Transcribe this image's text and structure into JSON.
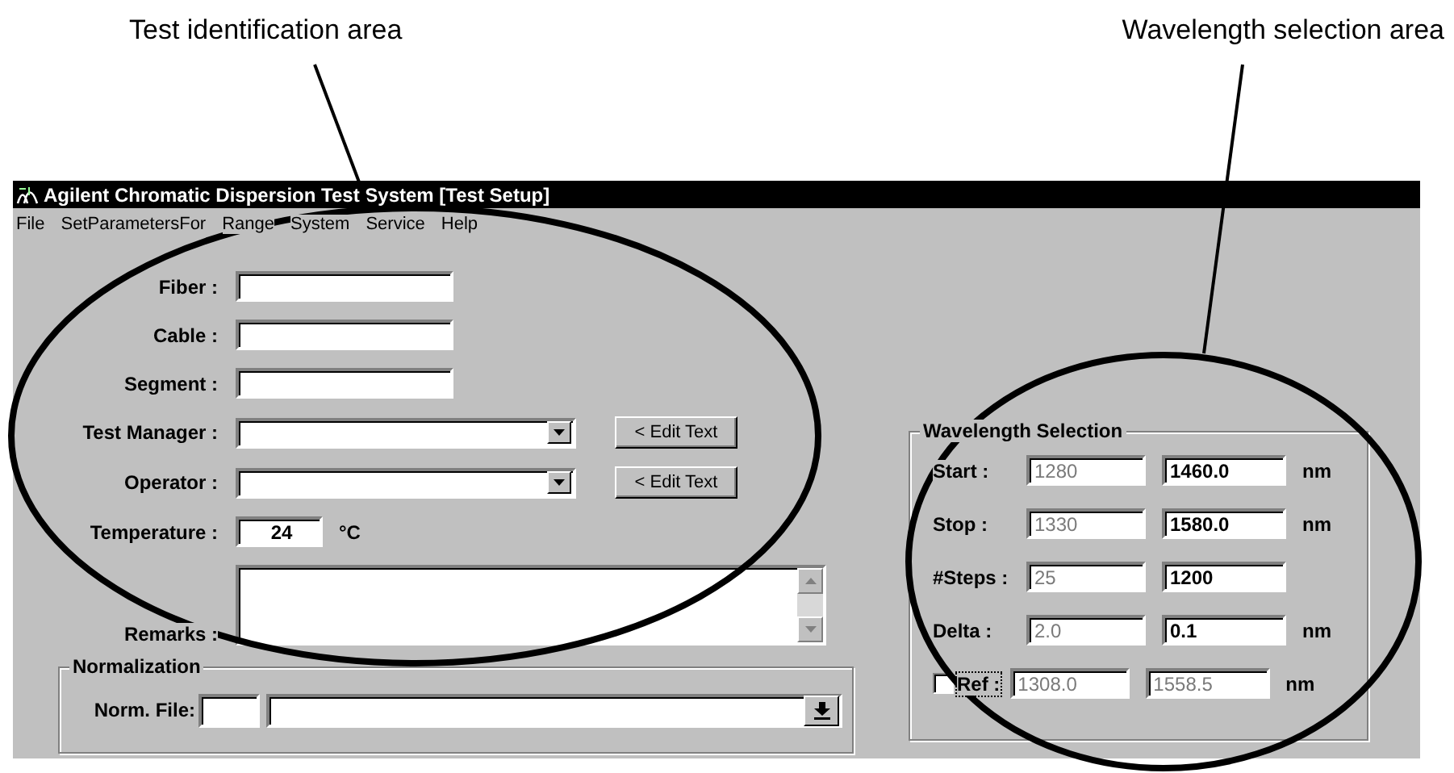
{
  "annotations": [
    {
      "label": "Test identification area"
    },
    {
      "label": "Wavelength selection area"
    }
  ],
  "window": {
    "title": "Agilent Chromatic Dispersion Test System [Test Setup]"
  },
  "menu": [
    "File",
    "SetParametersFor",
    "Range",
    "System",
    "Service",
    "Help"
  ],
  "test_identification": {
    "fields": [
      {
        "kind": "text",
        "label": "Fiber :"
      },
      {
        "kind": "text",
        "label": "Cable :"
      },
      {
        "kind": "text",
        "label": "Segment :"
      },
      {
        "kind": "combo",
        "label": "Test Manager :",
        "button": "< Edit Text"
      },
      {
        "kind": "combo",
        "label": "Operator :",
        "button": "< Edit Text"
      },
      {
        "kind": "number",
        "label": "Temperature :",
        "value": "24",
        "unit": "°C"
      },
      {
        "kind": "memo",
        "label": "Remarks :"
      }
    ]
  },
  "normalization": {
    "title": "Normalization",
    "label": "Norm. File:"
  },
  "wavelength_selection": {
    "title": "Wavelength Selection",
    "rows": [
      {
        "kind": "plain",
        "label": "Start :",
        "default": {
          "value": "1280",
          "disabled": true
        },
        "setting": {
          "value": "1460.0",
          "disabled": false
        },
        "unit": "nm"
      },
      {
        "kind": "plain",
        "label": "Stop :",
        "default": {
          "value": "1330",
          "disabled": true
        },
        "setting": {
          "value": "1580.0",
          "disabled": false
        },
        "unit": "nm"
      },
      {
        "kind": "plain",
        "label": "#Steps :",
        "default": {
          "value": "25",
          "disabled": true
        },
        "setting": {
          "value": "1200",
          "disabled": false
        }
      },
      {
        "kind": "plain",
        "label": "Delta :",
        "default": {
          "value": "2.0",
          "disabled": true
        },
        "setting": {
          "value": "0.1",
          "disabled": false
        },
        "unit": "nm"
      },
      {
        "kind": "checkbox",
        "label": "Ref :",
        "checked": false,
        "default": {
          "value": "1308.0",
          "disabled": true
        },
        "setting": {
          "value": "1558.5",
          "disabled": true
        },
        "unit": "nm"
      }
    ]
  }
}
